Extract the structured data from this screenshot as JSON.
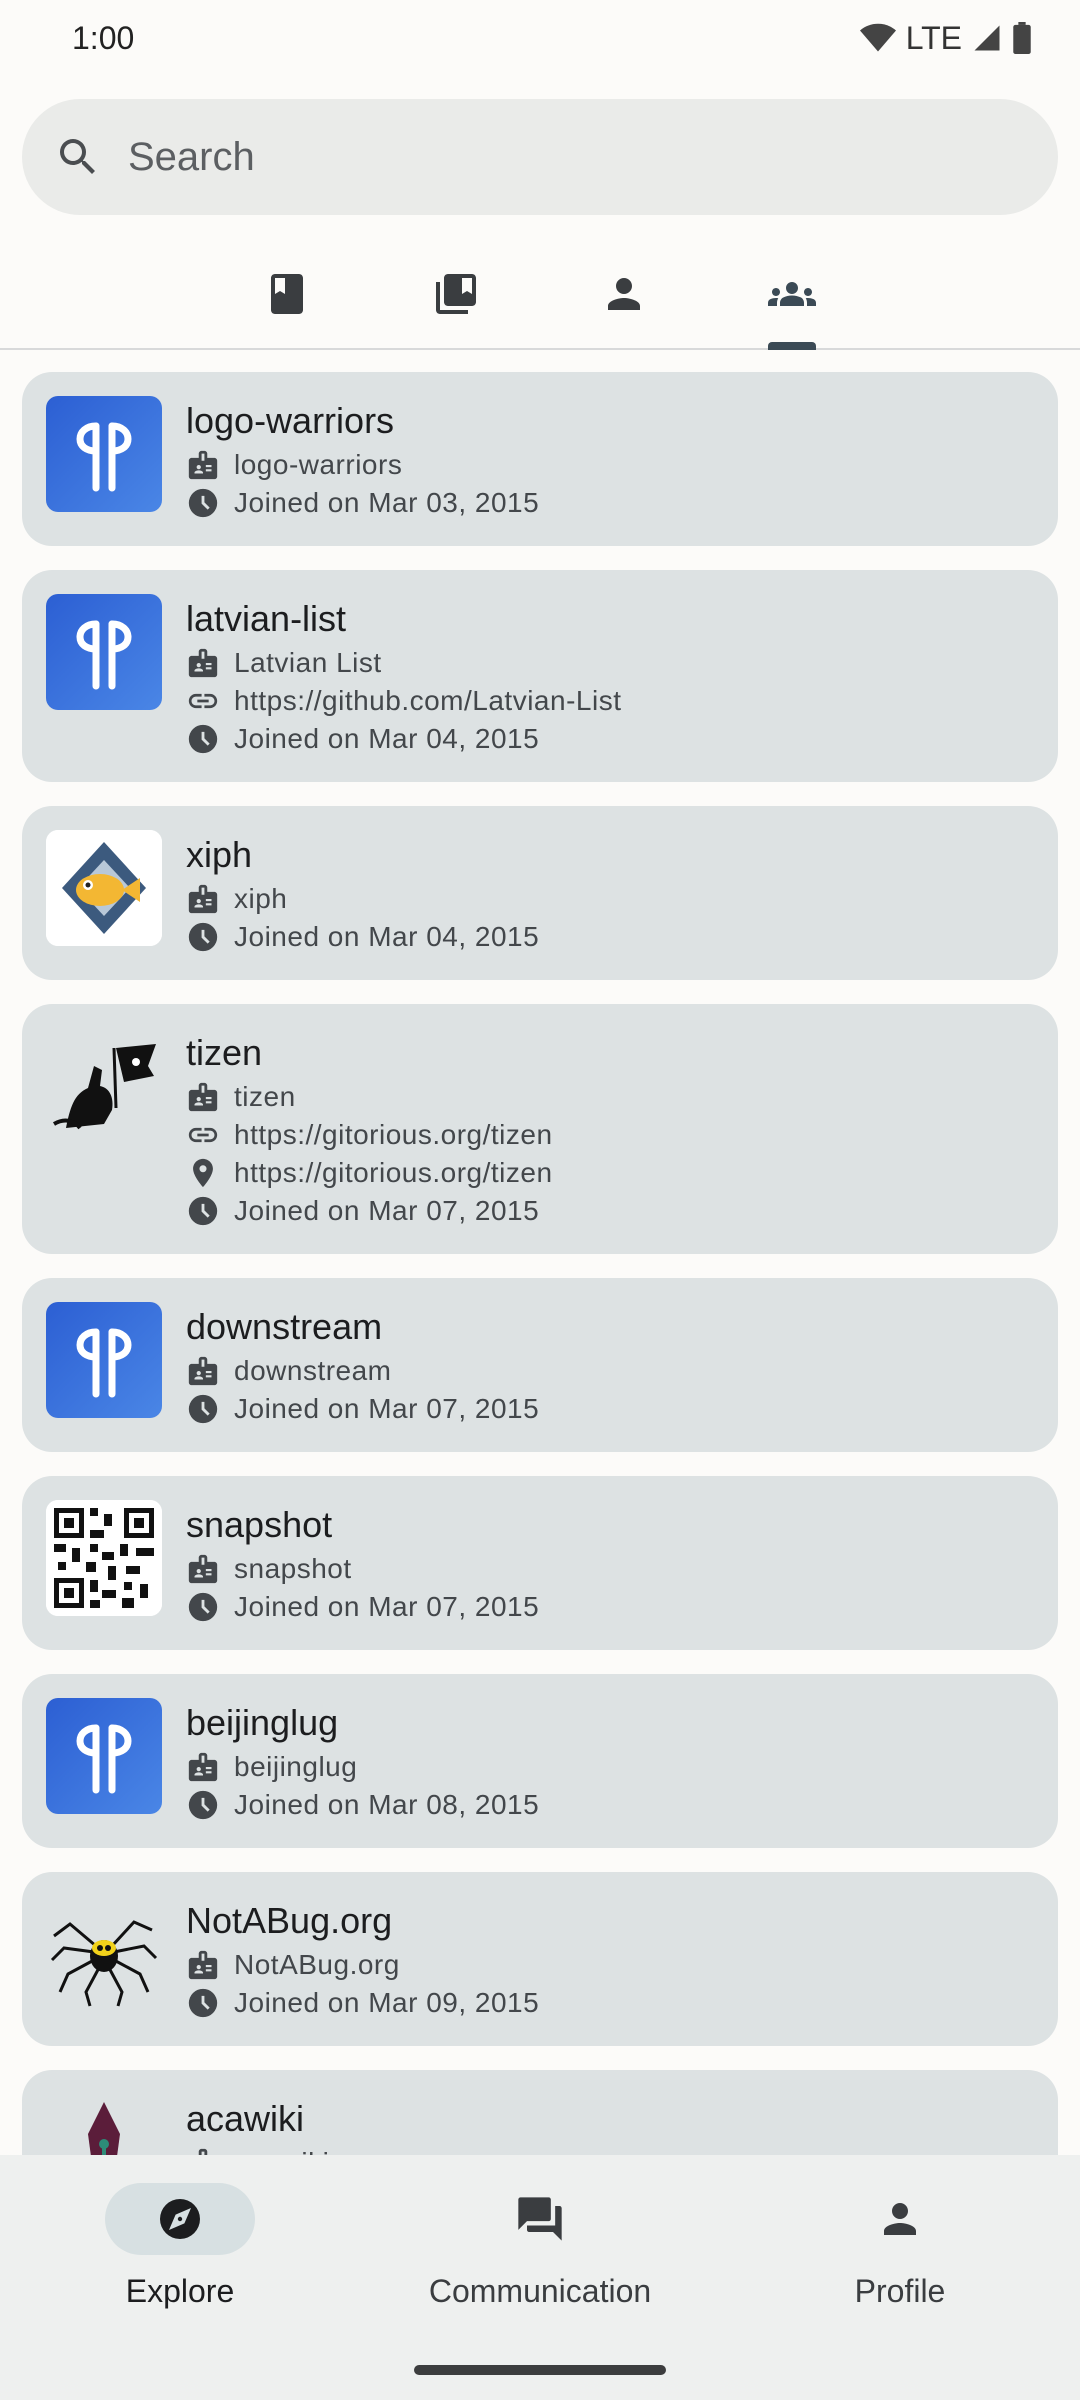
{
  "status_bar": {
    "time": "1:00",
    "network": "LTE"
  },
  "search": {
    "placeholder": "Search"
  },
  "tabs": [
    {
      "icon": "book-icon",
      "active": false
    },
    {
      "icon": "library-icon",
      "active": false
    },
    {
      "icon": "person-icon",
      "active": false
    },
    {
      "icon": "groups-icon",
      "active": true
    }
  ],
  "organizations": [
    {
      "name": "logo-warriors",
      "full_name": "logo-warriors",
      "joined": "Joined on Mar 03, 2015"
    },
    {
      "name": "latvian-list",
      "full_name": "Latvian List",
      "website": "https://github.com/Latvian-List",
      "joined": "Joined on Mar 04, 2015"
    },
    {
      "name": "xiph",
      "full_name": "xiph",
      "joined": "Joined on Mar 04, 2015"
    },
    {
      "name": "tizen",
      "full_name": "tizen",
      "website": "https://gitorious.org/tizen",
      "location": "https://gitorious.org/tizen",
      "joined": "Joined on Mar 07, 2015"
    },
    {
      "name": "downstream",
      "full_name": "downstream",
      "joined": "Joined on Mar 07, 2015"
    },
    {
      "name": "snapshot",
      "full_name": "snapshot",
      "joined": "Joined on Mar 07, 2015"
    },
    {
      "name": "beijinglug",
      "full_name": "beijinglug",
      "joined": "Joined on Mar 08, 2015"
    },
    {
      "name": "NotABug.org",
      "full_name": "NotABug.org",
      "joined": "Joined on Mar 09, 2015"
    },
    {
      "name": "acawiki",
      "full_name": "acawiki"
    }
  ],
  "bottom_nav": {
    "explore": "Explore",
    "communication": "Communication",
    "profile": "Profile"
  },
  "colors": {
    "card_bg": "#dde2e3",
    "default_avatar": "#3a6fd8",
    "active_indicator": "#3b4a55"
  }
}
